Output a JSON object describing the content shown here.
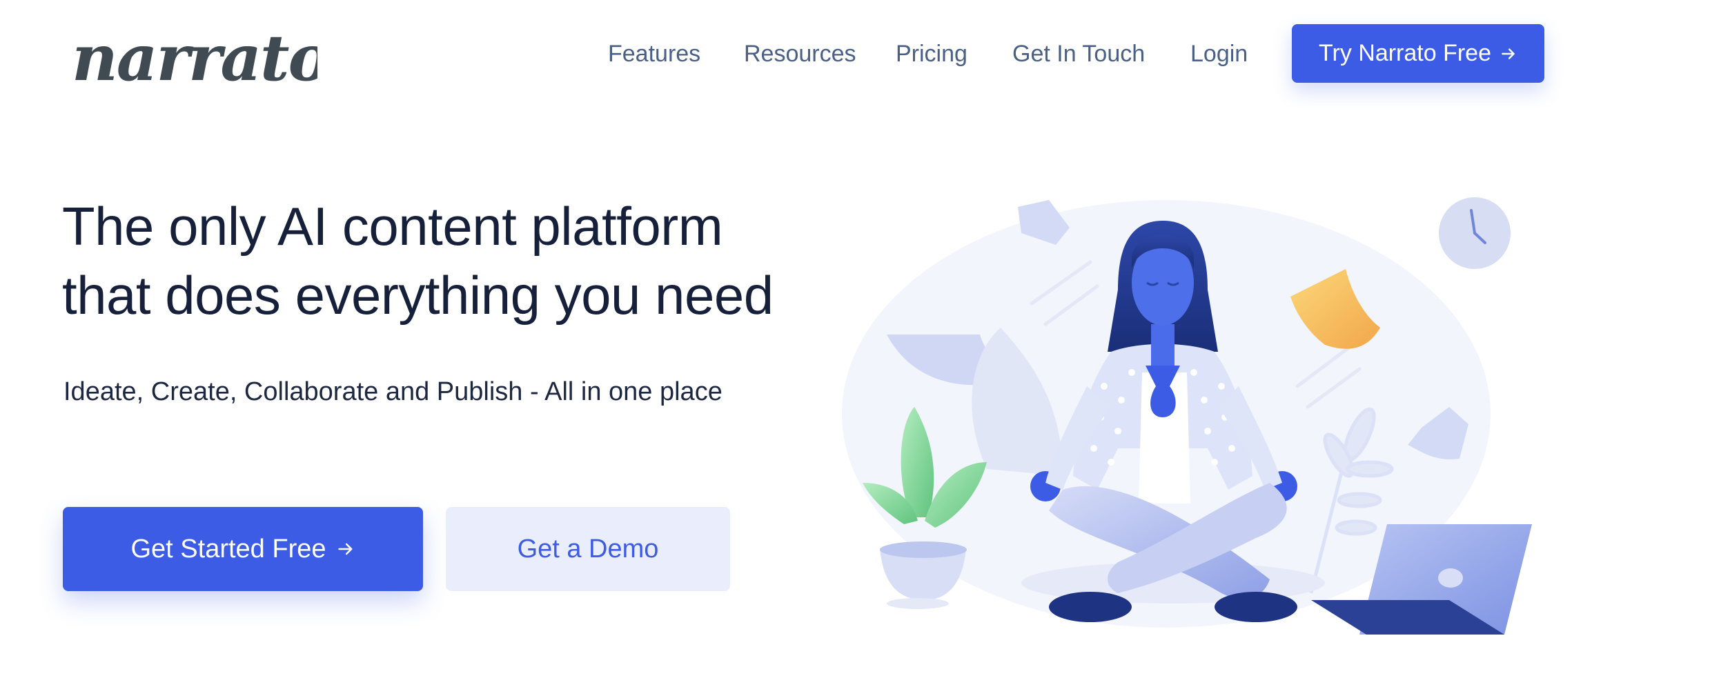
{
  "brand": {
    "logo_text": "narrato"
  },
  "nav": {
    "links": [
      "Features",
      "Resources",
      "Pricing",
      "Get In Touch",
      "Login"
    ],
    "cta_label": "Try Narrato Free"
  },
  "hero": {
    "title_line1": "The only AI content platform",
    "title_line2": "that does everything you need",
    "subtitle": "Ideate, Create, Collaborate and Publish - All in one place",
    "primary_button": "Get Started Free",
    "secondary_button": "Get a Demo"
  },
  "icons": {
    "arrow": "arrow-right-icon",
    "illustration": "meditating-woman-illustration"
  },
  "colors": {
    "brand_blue": "#3d5ce5",
    "nav_text": "#4a5f86",
    "heading": "#16203a",
    "secondary_bg": "#e9edfc",
    "logo": "#3f4a52"
  }
}
